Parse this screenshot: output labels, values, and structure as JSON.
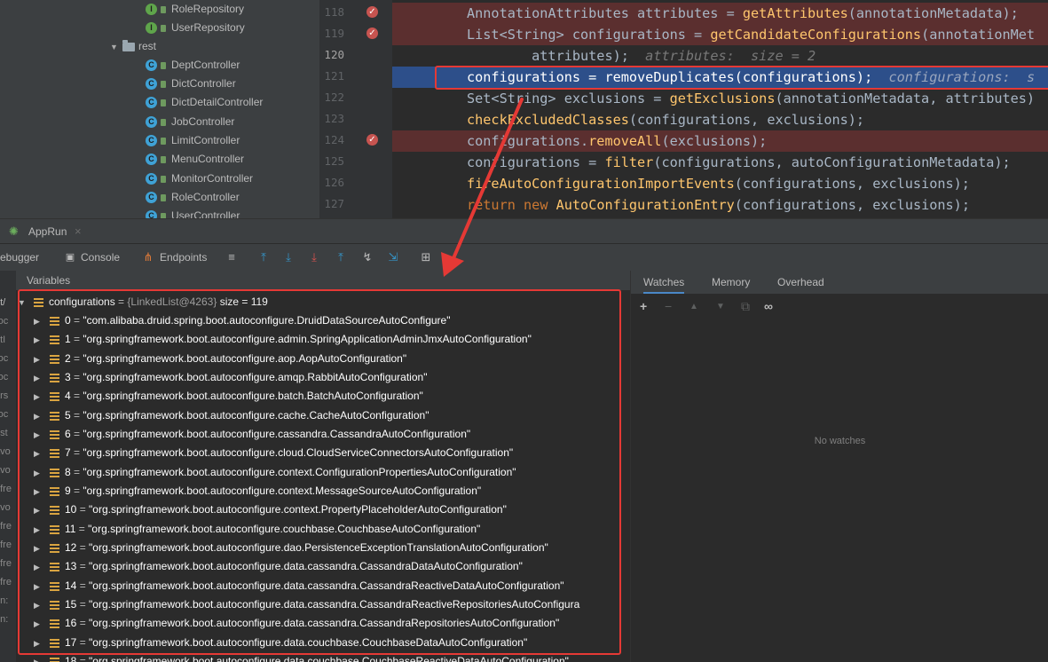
{
  "tree": {
    "items": [
      {
        "icon": "I",
        "kind": "i",
        "label": "RoleRepository"
      },
      {
        "icon": "I",
        "kind": "i",
        "label": "UserRepository"
      },
      {
        "icon": "folder",
        "kind": "folder",
        "label": "rest"
      },
      {
        "icon": "C",
        "kind": "c",
        "label": "DeptController"
      },
      {
        "icon": "C",
        "kind": "c",
        "label": "DictController"
      },
      {
        "icon": "C",
        "kind": "c",
        "label": "DictDetailController"
      },
      {
        "icon": "C",
        "kind": "c",
        "label": "JobController"
      },
      {
        "icon": "C",
        "kind": "c",
        "label": "LimitController"
      },
      {
        "icon": "C",
        "kind": "c",
        "label": "MenuController"
      },
      {
        "icon": "C",
        "kind": "c",
        "label": "MonitorController"
      },
      {
        "icon": "C",
        "kind": "c",
        "label": "RoleController"
      },
      {
        "icon": "C",
        "kind": "c",
        "label": "UserController"
      }
    ]
  },
  "editor": {
    "lines": [
      {
        "num": "118",
        "bp": true
      },
      {
        "num": "119",
        "bp": true
      },
      {
        "num": "120",
        "bp": false
      },
      {
        "num": "121",
        "bp": false
      },
      {
        "num": "122",
        "bp": false
      },
      {
        "num": "123",
        "bp": false
      },
      {
        "num": "124",
        "bp": true
      },
      {
        "num": "125",
        "bp": false
      },
      {
        "num": "126",
        "bp": false
      },
      {
        "num": "127",
        "bp": false
      }
    ],
    "code": {
      "l118": {
        "a": "AnnotationAttributes attributes = ",
        "f": "getAttributes",
        "b": "(annotationMetadata);"
      },
      "l119": {
        "a": "List<String> configurations = ",
        "f": "getCandidateConfigurations",
        "b": "(annotationMet"
      },
      "l120": {
        "a": "        attributes);  ",
        "h": "attributes:  size = 2"
      },
      "l121": {
        "a": "configurations = ",
        "f": "removeDuplicates",
        "b": "(configurations);  ",
        "h": "configurations:  s"
      },
      "l122": {
        "a": "Set<String> exclusions = ",
        "f": "getExclusions",
        "b": "(annotationMetadata, attributes)"
      },
      "l123": {
        "f": "checkExcludedClasses",
        "b": "(configurations, exclusions);"
      },
      "l124": {
        "a": "configurations.",
        "f": "removeAll",
        "b": "(exclusions);"
      },
      "l125": {
        "a": "configurations = ",
        "f": "filter",
        "b": "(configurations, autoConfigurationMetadata);"
      },
      "l126": {
        "f": "fireAutoConfigurationImportEvents",
        "b": "(configurations, exclusions);"
      },
      "l127": {
        "k1": "return",
        "k2": "new",
        "f": "AutoConfigurationEntry",
        "b": "(configurations, exclusions);"
      }
    }
  },
  "tool_window": {
    "run_tab": "AppRun",
    "close_glyph": "×",
    "tabs": {
      "debugger": "ebugger",
      "console": "Console",
      "endpoints": "Endpoints"
    }
  },
  "variables": {
    "header": "Variables",
    "root": {
      "name": "configurations",
      "eq": " = ",
      "type": "{LinkedList@4263}",
      "size": "size = 119"
    },
    "items": [
      {
        "idx": "0",
        "val": "\"com.alibaba.druid.spring.boot.autoconfigure.DruidDataSourceAutoConfigure\""
      },
      {
        "idx": "1",
        "val": "\"org.springframework.boot.autoconfigure.admin.SpringApplicationAdminJmxAutoConfiguration\""
      },
      {
        "idx": "2",
        "val": "\"org.springframework.boot.autoconfigure.aop.AopAutoConfiguration\""
      },
      {
        "idx": "3",
        "val": "\"org.springframework.boot.autoconfigure.amqp.RabbitAutoConfiguration\""
      },
      {
        "idx": "4",
        "val": "\"org.springframework.boot.autoconfigure.batch.BatchAutoConfiguration\""
      },
      {
        "idx": "5",
        "val": "\"org.springframework.boot.autoconfigure.cache.CacheAutoConfiguration\""
      },
      {
        "idx": "6",
        "val": "\"org.springframework.boot.autoconfigure.cassandra.CassandraAutoConfiguration\""
      },
      {
        "idx": "7",
        "val": "\"org.springframework.boot.autoconfigure.cloud.CloudServiceConnectorsAutoConfiguration\""
      },
      {
        "idx": "8",
        "val": "\"org.springframework.boot.autoconfigure.context.ConfigurationPropertiesAutoConfiguration\""
      },
      {
        "idx": "9",
        "val": "\"org.springframework.boot.autoconfigure.context.MessageSourceAutoConfiguration\""
      },
      {
        "idx": "10",
        "val": "\"org.springframework.boot.autoconfigure.context.PropertyPlaceholderAutoConfiguration\""
      },
      {
        "idx": "11",
        "val": "\"org.springframework.boot.autoconfigure.couchbase.CouchbaseAutoConfiguration\""
      },
      {
        "idx": "12",
        "val": "\"org.springframework.boot.autoconfigure.dao.PersistenceExceptionTranslationAutoConfiguration\""
      },
      {
        "idx": "13",
        "val": "\"org.springframework.boot.autoconfigure.data.cassandra.CassandraDataAutoConfiguration\""
      },
      {
        "idx": "14",
        "val": "\"org.springframework.boot.autoconfigure.data.cassandra.CassandraReactiveDataAutoConfiguration\""
      },
      {
        "idx": "15",
        "val": "\"org.springframework.boot.autoconfigure.data.cassandra.CassandraReactiveRepositoriesAutoConfigura"
      },
      {
        "idx": "16",
        "val": "\"org.springframework.boot.autoconfigure.data.cassandra.CassandraRepositoriesAutoConfiguration\""
      },
      {
        "idx": "17",
        "val": "\"org.springframework.boot.autoconfigure.data.couchbase.CouchbaseDataAutoConfiguration\""
      },
      {
        "idx": "18",
        "val": "\"org.springframework.boot.autoconfigure.data.couchbase.CouchbaseReactiveDataAutoConfiguration\""
      }
    ]
  },
  "left_strip": [
    "et/",
    "roc",
    "etI",
    "roc",
    "roc",
    "ars",
    "roc",
    "ost",
    "avo",
    "avo",
    "efre",
    "avo",
    "efre",
    "efre",
    "efre",
    "efre",
    "un:",
    "un:"
  ],
  "watches": {
    "tabs": {
      "watches": "Watches",
      "memory": "Memory",
      "overhead": "Overhead"
    },
    "empty_text": "No watches"
  },
  "colors": {
    "annotation": "#e53935",
    "breakpoint_line": "#5b2f2f",
    "current_line": "#2d4f8a"
  }
}
